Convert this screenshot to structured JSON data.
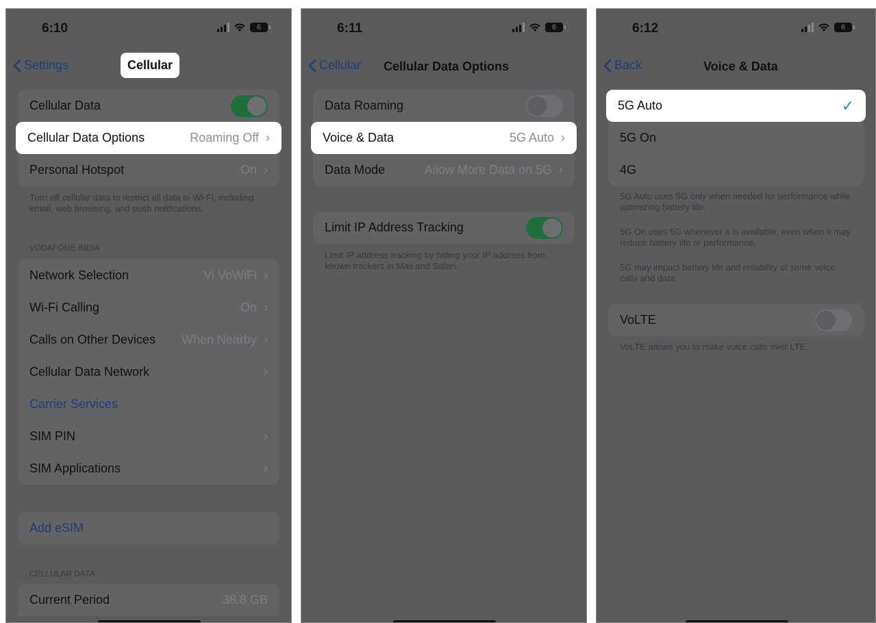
{
  "colors": {
    "accent": "#1f3f73",
    "check": "#2a7af0",
    "toggle_on": "#1f6f3a",
    "dim_bg": "#5b5b5e"
  },
  "screen1": {
    "time": "6:10",
    "battery": "6",
    "back_label": "Settings",
    "title": "Cellular",
    "cellular_data": {
      "label": "Cellular Data",
      "toggle": "on"
    },
    "cellular_data_options": {
      "label": "Cellular Data Options",
      "value": "Roaming Off"
    },
    "personal_hotspot": {
      "label": "Personal Hotspot",
      "value": "On"
    },
    "info_text": "Turn off cellular data to restrict all data to Wi-Fi, including email, web browsing, and push notifications.",
    "carrier_header": "VODAFONE INDIA",
    "carrier_rows": [
      {
        "label": "Network Selection",
        "value": "Vi VoWiFi"
      },
      {
        "label": "Wi-Fi Calling",
        "value": "On"
      },
      {
        "label": "Calls on Other Devices",
        "value": "When Nearby"
      },
      {
        "label": "Cellular Data Network",
        "value": ""
      },
      {
        "label": "Carrier Services",
        "value": ""
      },
      {
        "label": "SIM PIN",
        "value": ""
      },
      {
        "label": "SIM Applications",
        "value": ""
      }
    ],
    "add_esim": "Add eSIM",
    "data_header": "CELLULAR DATA",
    "current_period": {
      "label": "Current Period",
      "value": "38.8 GB"
    }
  },
  "screen2": {
    "time": "6:11",
    "battery": "6",
    "back_label": "Cellular",
    "title": "Cellular Data Options",
    "data_roaming": {
      "label": "Data Roaming",
      "toggle": "off"
    },
    "voice_data": {
      "label": "Voice & Data",
      "value": "5G Auto"
    },
    "data_mode": {
      "label": "Data Mode",
      "value": "Allow More Data on 5G"
    },
    "limit_ip": {
      "label": "Limit IP Address Tracking",
      "toggle": "on"
    },
    "limit_ip_footer": "Limit IP address tracking by hiding your IP address from known trackers in Mail and Safari."
  },
  "screen3": {
    "time": "6:12",
    "battery": "6",
    "back_label": "Back",
    "title": "Voice & Data",
    "options": [
      {
        "label": "5G Auto",
        "selected": true,
        "check": "✓"
      },
      {
        "label": "5G On",
        "selected": false
      },
      {
        "label": "4G",
        "selected": false
      }
    ],
    "footer_1": "5G Auto uses 5G only when needed for performance while optimizing battery life.",
    "footer_2": "5G On uses 5G whenever it is available, even when it may reduce battery life or performance.",
    "footer_3": "5G may impact battery life and reliability of some voice calls and data.",
    "volte": {
      "label": "VoLTE",
      "toggle": "off"
    },
    "volte_footer": "VoLTE allows you to make voice calls over LTE."
  }
}
